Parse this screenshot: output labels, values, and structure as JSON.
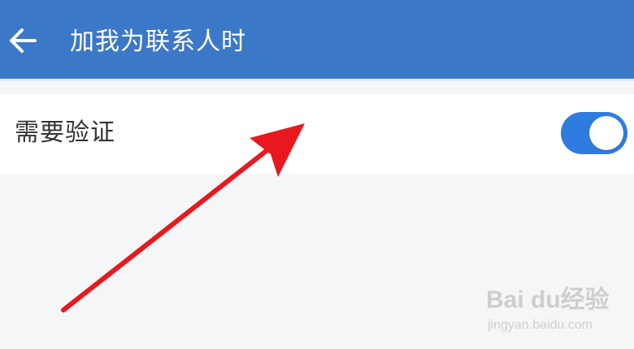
{
  "header": {
    "title": "加我为联系人时",
    "back_icon": "arrow-left-icon",
    "background_color": "#3b78c8"
  },
  "settings": {
    "verification": {
      "label": "需要验证",
      "enabled": true,
      "toggle_color": "#2f7ce0"
    }
  },
  "annotation": {
    "arrow_color": "#e8191e"
  },
  "watermark": {
    "brand": "Bai du经验",
    "url": "jingyan.baidu.com"
  }
}
